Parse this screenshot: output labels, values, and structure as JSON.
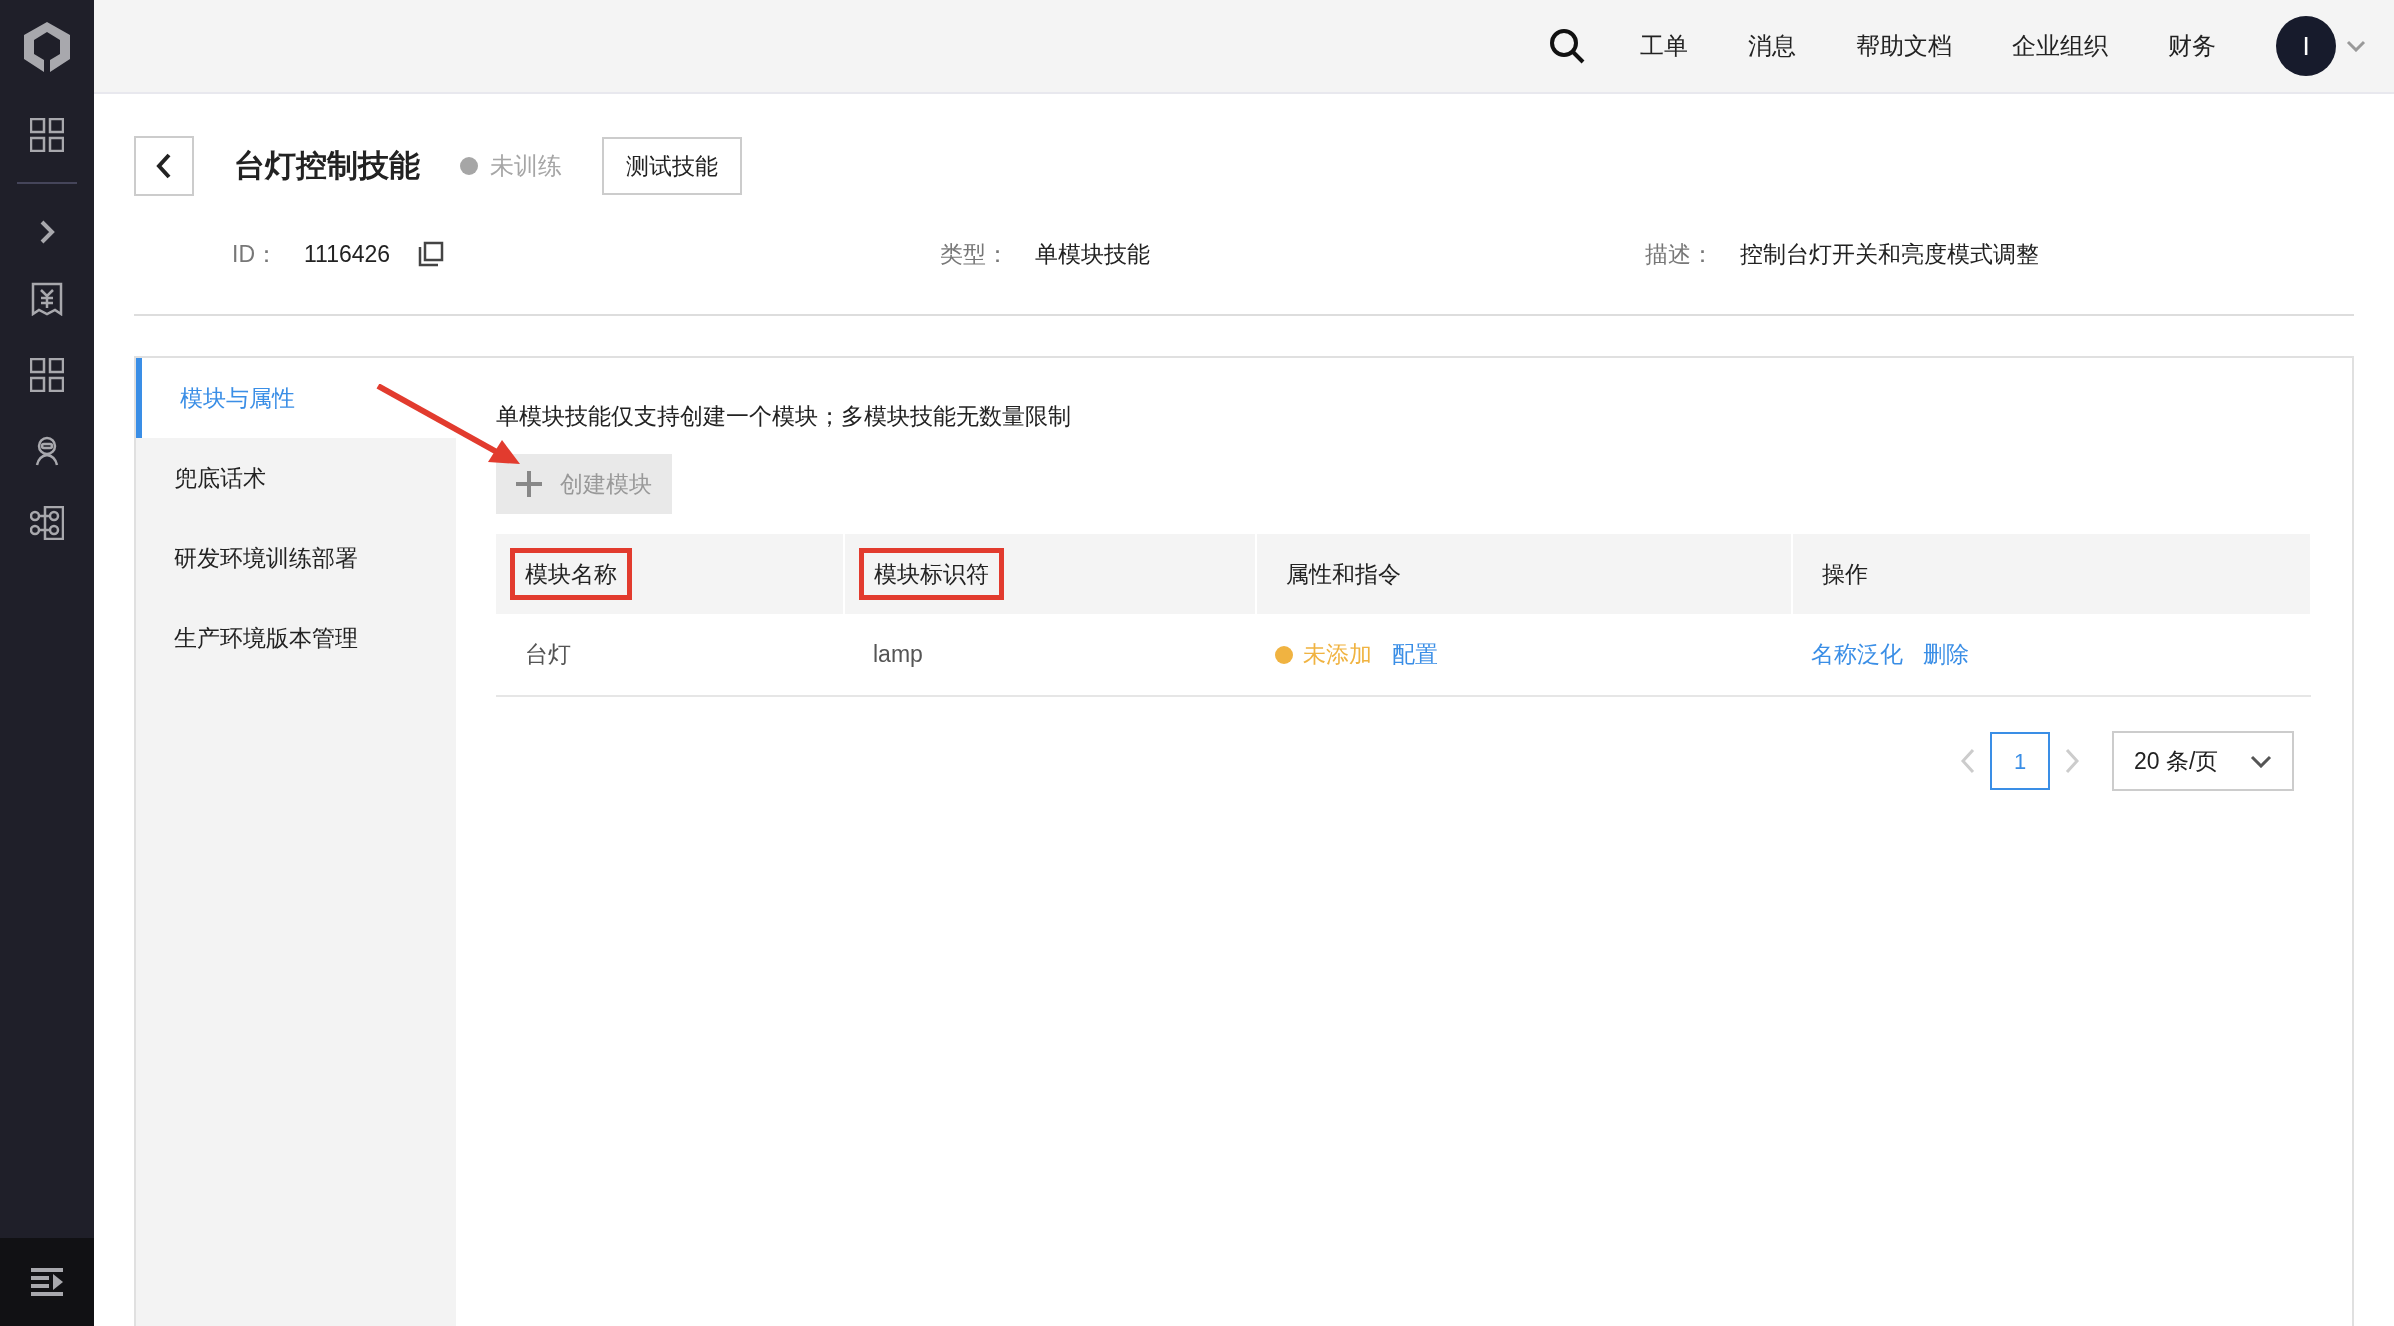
{
  "top_nav": {
    "links": [
      "工单",
      "消息",
      "帮助文档",
      "企业组织",
      "财务"
    ],
    "avatar": "I"
  },
  "skill": {
    "title": "台灯控制技能",
    "status": {
      "label": "未训练",
      "color": "#a6a6a6"
    },
    "test_button": "测试技能",
    "fields": [
      {
        "label": "ID：",
        "value": "1116426",
        "copyable": true
      },
      {
        "label": "类型：",
        "value": "单模块技能",
        "copyable": false
      },
      {
        "label": "描述：",
        "value": "控制台灯开关和亮度模式调整",
        "copyable": false
      }
    ]
  },
  "tabs": [
    {
      "label": "模块与属性",
      "selected": true
    },
    {
      "label": "兜底话术",
      "selected": false
    },
    {
      "label": "研发环境训练部署",
      "selected": false
    },
    {
      "label": "生产环境版本管理",
      "selected": false
    }
  ],
  "hint": "单模块技能仅支持创建一个模块；多模块技能无数量限制",
  "create_button": {
    "label": "创建模块",
    "disabled": true
  },
  "table": {
    "columns": [
      {
        "label": "模块名称",
        "highlighted": true
      },
      {
        "label": "模块标识符",
        "highlighted": true
      },
      {
        "label": "属性和指令",
        "highlighted": false
      },
      {
        "label": "操作",
        "highlighted": false
      }
    ],
    "rows": [
      {
        "name": "台灯",
        "identifier": "lamp",
        "status": {
          "label": "未添加",
          "color": "#f0b341"
        },
        "config_link": "配置",
        "actions": [
          "名称泛化",
          "删除"
        ]
      }
    ]
  },
  "pagination": {
    "pages": [
      {
        "label": "1",
        "selected": true
      }
    ],
    "page_size": "20 条/页"
  }
}
